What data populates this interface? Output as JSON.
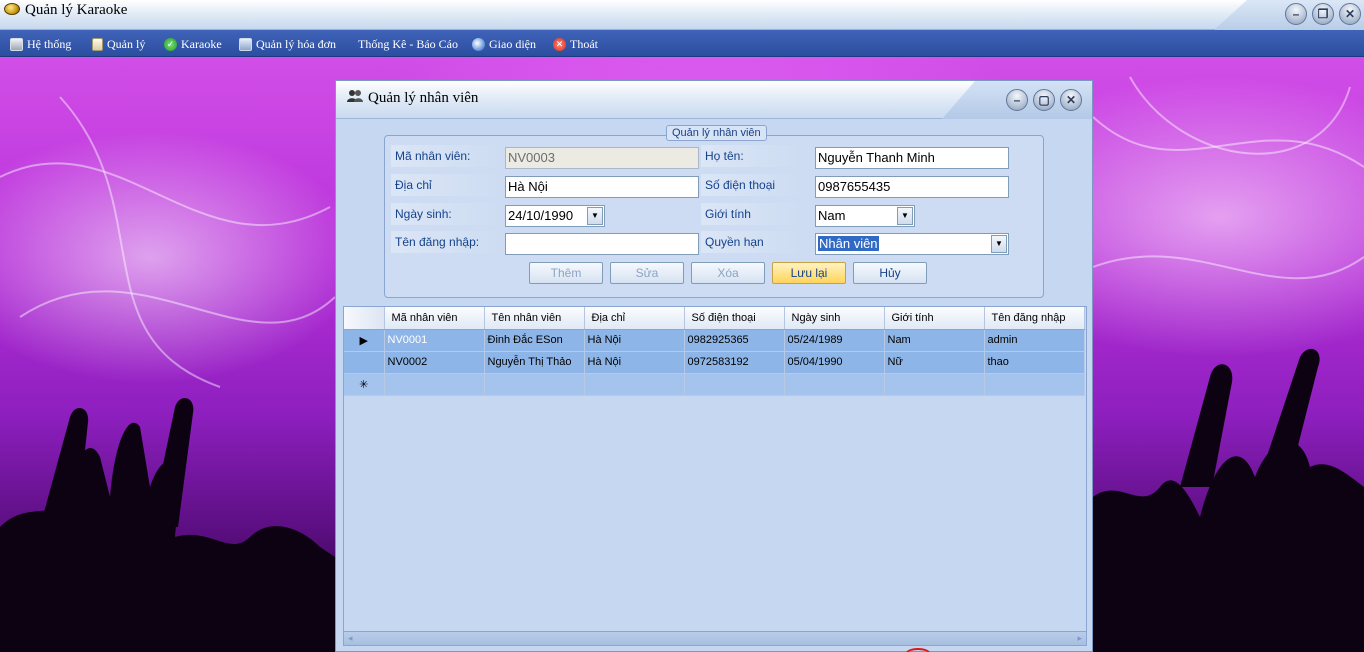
{
  "app": {
    "title": "Quản lý Karaoke",
    "window_buttons": {
      "minimize": "–",
      "restore": "❐",
      "close": "✕"
    }
  },
  "menu": [
    {
      "label": "Hệ thống",
      "icon": "system-icon"
    },
    {
      "label": "Quản lý",
      "icon": "document-icon"
    },
    {
      "label": "Karaoke",
      "icon": "check-icon"
    },
    {
      "label": "Quản lý hóa đơn",
      "icon": "invoice-icon"
    },
    {
      "label": "Thống Kê - Báo Cáo",
      "icon": ""
    },
    {
      "label": "Giao diện",
      "icon": "theme-icon"
    },
    {
      "label": "Thoát",
      "icon": "exit-icon"
    }
  ],
  "child_window": {
    "title": "Quản lý nhân viên",
    "window_buttons": {
      "minimize": "–",
      "maximize": "▢",
      "close": "✕"
    }
  },
  "form": {
    "group_title": "Quản lý nhân viên",
    "fields": {
      "employee_id": {
        "label": "Mã nhân viên:",
        "value": "NV0003"
      },
      "full_name": {
        "label": "Họ tên:",
        "value": "Nguyễn Thanh Minh"
      },
      "address": {
        "label": "Địa chỉ",
        "value": "Hà Nội"
      },
      "phone": {
        "label": "Số điện thoại",
        "value": "0987655435"
      },
      "birthday": {
        "label": "Ngày sinh:",
        "value": "24/10/1990"
      },
      "gender": {
        "label": "Giới tính",
        "value": "Nam"
      },
      "username": {
        "label": "Tên đăng nhập:",
        "value": ""
      },
      "role": {
        "label": "Quyền hạn",
        "value": "Nhân viên"
      }
    },
    "buttons": {
      "add": "Thêm",
      "edit": "Sửa",
      "delete": "Xóa",
      "save": "Lưu lại",
      "cancel": "Hủy"
    }
  },
  "grid": {
    "columns": [
      "Mã nhân viên",
      "Tên nhân viên",
      "Địa chỉ",
      "Số điện thoại",
      "Ngày sinh",
      "Giới tính",
      "Tên đăng nhập"
    ],
    "rows": [
      [
        "NV0001",
        "Đinh Đắc ESon",
        "Hà Nội",
        "0982925365",
        "05/24/1989",
        "Nam",
        "admin"
      ],
      [
        "NV0002",
        "Nguyễn Thị Thảo",
        "Hà Nội",
        "0972583192",
        "05/04/1990",
        "Nữ",
        "thao"
      ]
    ],
    "current_row_marker": "▶",
    "new_row_marker": "✳",
    "scroll_left": "◂",
    "scroll_right": "▸"
  }
}
